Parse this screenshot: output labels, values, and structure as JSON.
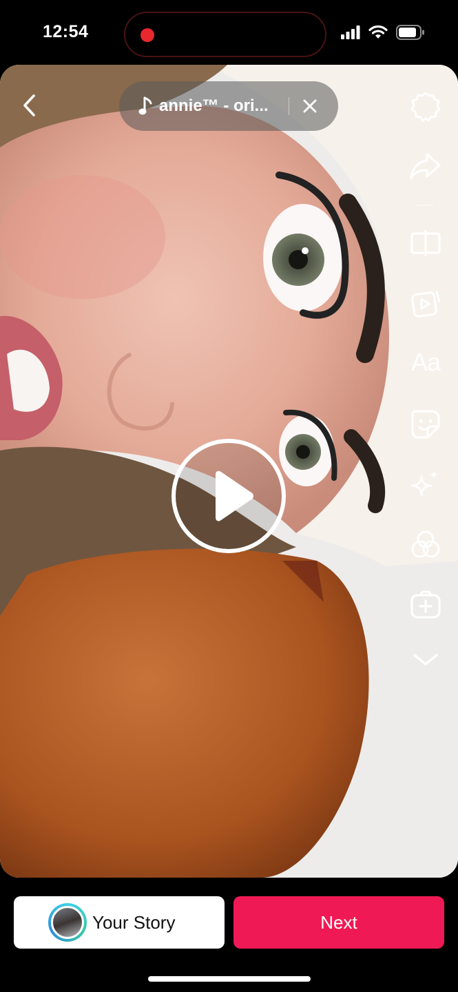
{
  "status_bar": {
    "time": "12:54",
    "recording_indicator_color": "#e8282e",
    "icons": [
      "cellular-signal-icon",
      "wifi-icon",
      "battery-icon"
    ]
  },
  "editor": {
    "music": {
      "title": "annie™ - ori...",
      "icon": "music-note-icon"
    },
    "toolbar": [
      "settings-icon",
      "share-icon",
      "mirror-icon",
      "clips-icon",
      "text-icon",
      "sticker-icon",
      "effects-icon",
      "filters-icon",
      "add-media-icon",
      "expand-more-icon"
    ],
    "text_tool_label": "Aa"
  },
  "bottom": {
    "story_label": "Your Story",
    "next_label": "Next",
    "next_color": "#ef1a55"
  }
}
